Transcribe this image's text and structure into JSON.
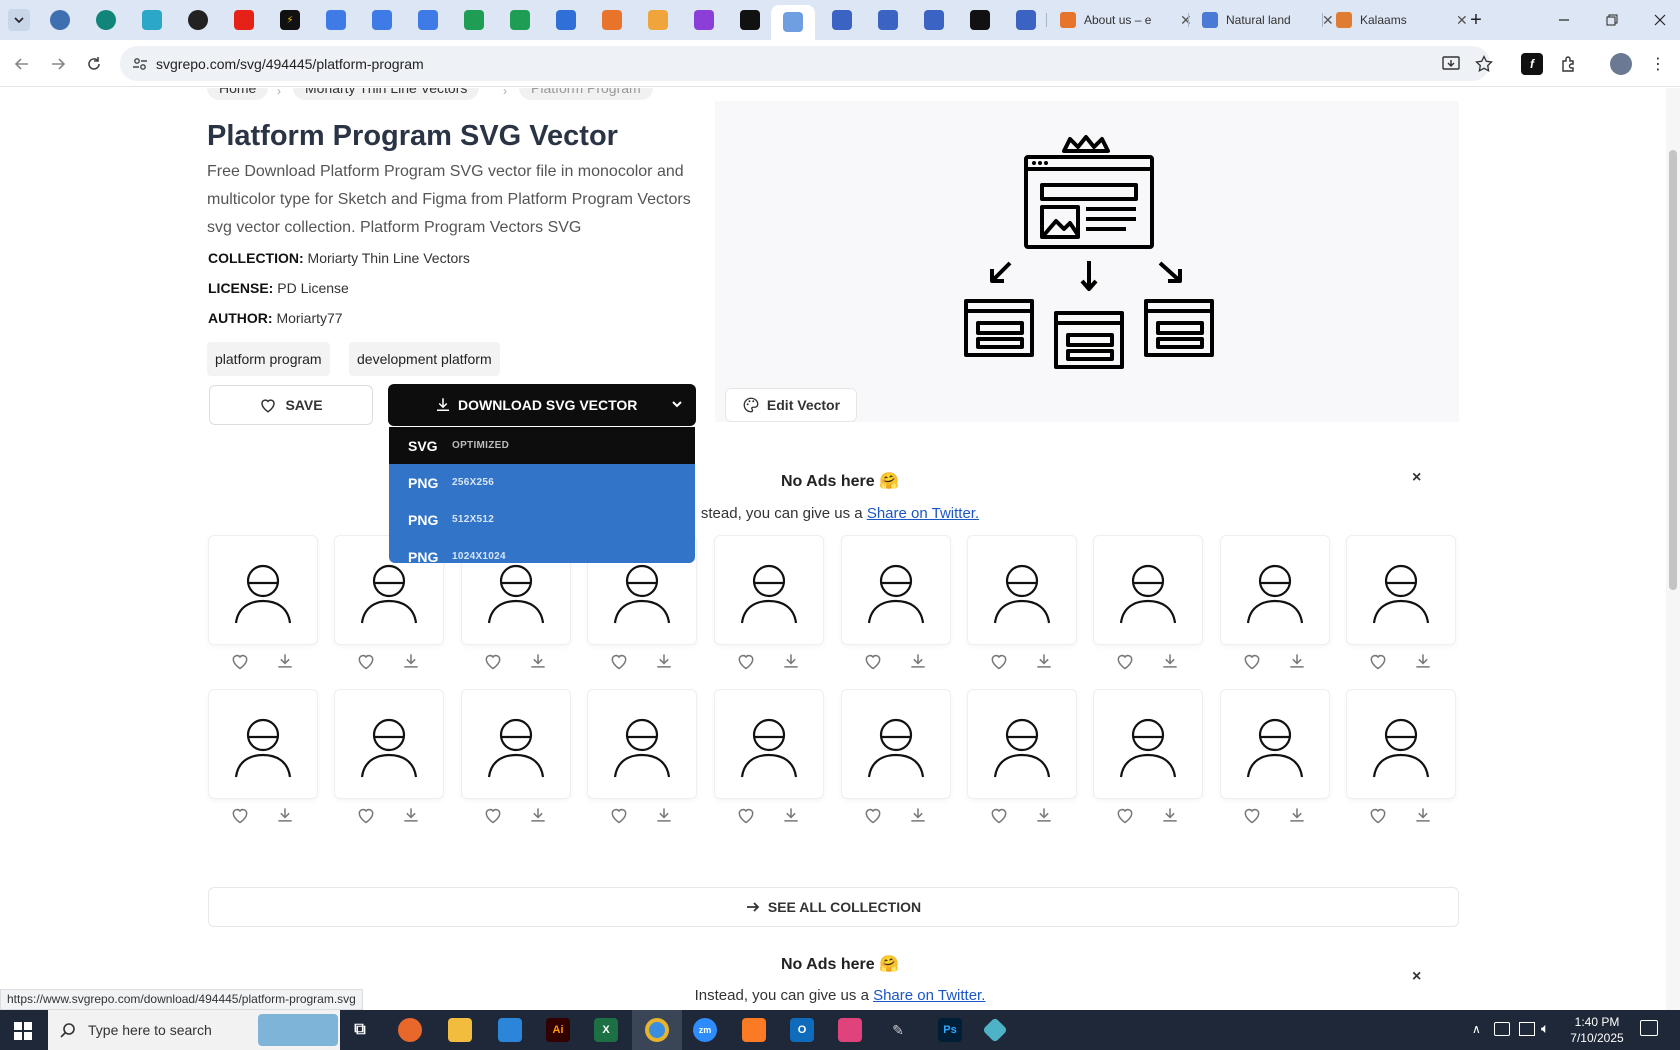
{
  "browser": {
    "tabs_named": [
      {
        "title": "About us – e",
        "color": "#e8742b"
      },
      {
        "title": "Natural land",
        "color": "#4a7ad6"
      },
      {
        "title": "Kalaams",
        "color": "#e07b32"
      }
    ],
    "url": "svgrepo.com/svg/494445/platform-program",
    "status_url": "https://www.svgrepo.com/download/494445/platform-program.svg"
  },
  "breadcrumbs": [
    "Home",
    "Moriarty Thin Line Vectors",
    "Platform Program"
  ],
  "title": "Platform Program SVG Vector",
  "description": "Free Download Platform Program SVG vector file in monocolor and multicolor type for Sketch and Figma from Platform Program Vectors svg vector collection. Platform Program Vectors SVG",
  "meta": {
    "collection_label": "COLLECTION:",
    "collection": "Moriarty Thin Line Vectors",
    "license_label": "LICENSE:",
    "license": "PD License",
    "author_label": "AUTHOR:",
    "author": "Moriarty77"
  },
  "tags": [
    "platform program",
    "development platform"
  ],
  "actions": {
    "save": "SAVE",
    "download": "DOWNLOAD SVG VECTOR",
    "edit": "Edit Vector"
  },
  "download_options": [
    {
      "format": "SVG",
      "size": "OPTIMIZED"
    },
    {
      "format": "PNG",
      "size": "256X256"
    },
    {
      "format": "PNG",
      "size": "512X512"
    },
    {
      "format": "PNG",
      "size": "1024X1024"
    }
  ],
  "ads": {
    "title": "No Ads here",
    "emoji": "🤗",
    "line": "Instead, you can give us a",
    "line_visible": "stead, you can give us a",
    "link": "Share on Twitter.",
    "close": "×"
  },
  "icons_row1": [
    "man-glasses-icon",
    "presentation-board-icon",
    "briefcase-icon",
    "lightbulb-businessman-icon",
    "target-arrow-icon",
    "handshake-icon",
    "brain-storm-icon",
    "money-tree-icon",
    "santa-icon",
    "computer-monitor-icon"
  ],
  "icons_row2": [
    "newspaper-megaphone-icon",
    "businessman-icon",
    "shopping-cart-icon",
    "gifts-icon",
    "wallet-card-icon",
    "shopping-bag-icon",
    "lightbulb-face-icon",
    "woman-icon",
    "megaphone-social-icon",
    "platform-program-icon"
  ],
  "see_all": "SEE ALL COLLECTION",
  "taskbar": {
    "search_placeholder": "Type here to search",
    "time": "1:40 PM",
    "date": "7/10/2025"
  },
  "colors": {
    "accent": "#3275c8",
    "dark": "#0d0d0d",
    "link": "#1a56c4"
  }
}
